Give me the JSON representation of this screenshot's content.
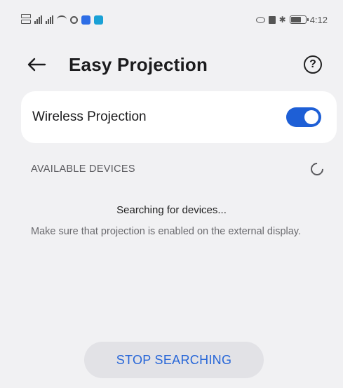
{
  "status_bar": {
    "time": "4:12",
    "icons": [
      "dual-sim-icon",
      "signal-icon",
      "signal-icon",
      "wifi-icon",
      "circle-icon",
      "app-badge-icon",
      "app-badge-icon",
      "eye-icon",
      "nfc-icon",
      "bluetooth-icon",
      "battery-icon"
    ]
  },
  "header": {
    "title": "Easy Projection",
    "back_icon": "arrow-left-icon",
    "help_icon": "question-mark-icon",
    "help_glyph": "?"
  },
  "wireless": {
    "label": "Wireless Projection",
    "enabled": true,
    "toggle_color": "#1e5fd6"
  },
  "devices": {
    "section_title": "AVAILABLE DEVICES",
    "status": "Searching for devices...",
    "hint": "Make sure that projection is enabled on the external display."
  },
  "action": {
    "stop_label": "STOP SEARCHING",
    "accent_color": "#2766d8"
  }
}
